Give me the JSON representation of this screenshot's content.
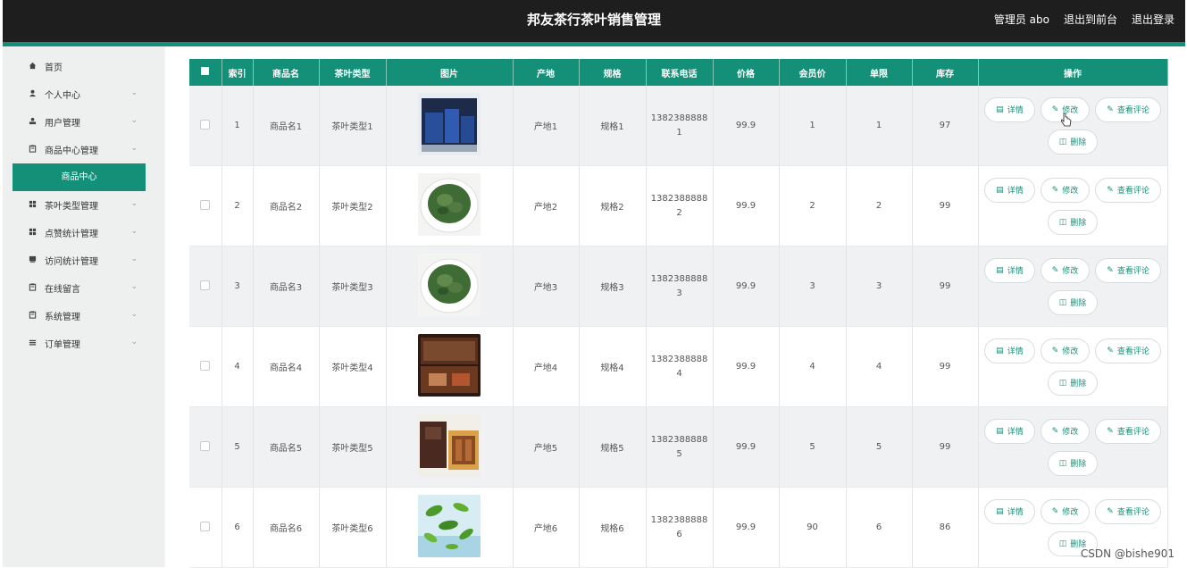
{
  "header": {
    "title": "邦友茶行茶叶销售管理",
    "admin": "管理员 abo",
    "front": "退出到前台",
    "logout": "退出登录"
  },
  "sidebar": {
    "items": [
      {
        "label": "首页",
        "icon": "home-icon",
        "chevron": false
      },
      {
        "label": "个人中心",
        "icon": "person-icon",
        "chevron": true
      },
      {
        "label": "用户管理",
        "icon": "user-icon",
        "chevron": true
      },
      {
        "label": "商品中心管理",
        "icon": "clipboard-icon",
        "chevron": true
      },
      {
        "label": "茶叶类型管理",
        "icon": "grid-icon",
        "chevron": true
      },
      {
        "label": "点赞统计管理",
        "icon": "grid-icon",
        "chevron": true
      },
      {
        "label": "访问统计管理",
        "icon": "book-icon",
        "chevron": true
      },
      {
        "label": "在线留言",
        "icon": "clipboard-icon",
        "chevron": true
      },
      {
        "label": "系统管理",
        "icon": "clipboard-icon",
        "chevron": true
      },
      {
        "label": "订单管理",
        "icon": "list-icon",
        "chevron": true
      }
    ],
    "active_sub": "商品中心"
  },
  "table": {
    "headers": [
      "索引",
      "商品名",
      "茶叶类型",
      "图片",
      "产地",
      "规格",
      "联系电话",
      "价格",
      "会员价",
      "单限",
      "库存",
      "操作"
    ],
    "rows": [
      {
        "idx": "1",
        "name": "商品名1",
        "type": "茶叶类型1",
        "img": "blue-gift-box",
        "origin": "产地1",
        "spec": "规格1",
        "phone1": "1382388888",
        "phone2": "1",
        "price": "99.9",
        "member": "1",
        "limit": "1",
        "stock": "97"
      },
      {
        "idx": "2",
        "name": "商品名2",
        "type": "茶叶类型2",
        "img": "green-tea-bowl",
        "origin": "产地2",
        "spec": "规格2",
        "phone1": "1382388888",
        "phone2": "2",
        "price": "99.9",
        "member": "2",
        "limit": "2",
        "stock": "99"
      },
      {
        "idx": "3",
        "name": "商品名3",
        "type": "茶叶类型3",
        "img": "green-tea-bowl",
        "origin": "产地3",
        "spec": "规格3",
        "phone1": "1382388888",
        "phone2": "3",
        "price": "99.9",
        "member": "3",
        "limit": "3",
        "stock": "99"
      },
      {
        "idx": "4",
        "name": "商品名4",
        "type": "茶叶类型4",
        "img": "wooden-tea-box",
        "origin": "产地4",
        "spec": "规格4",
        "phone1": "1382388888",
        "phone2": "4",
        "price": "99.9",
        "member": "4",
        "limit": "4",
        "stock": "99"
      },
      {
        "idx": "5",
        "name": "商品名5",
        "type": "茶叶类型5",
        "img": "tea-gift-set",
        "origin": "产地5",
        "spec": "规格5",
        "phone1": "1382388888",
        "phone2": "5",
        "price": "99.9",
        "member": "5",
        "limit": "5",
        "stock": "99"
      },
      {
        "idx": "6",
        "name": "商品名6",
        "type": "茶叶类型6",
        "img": "flying-tea-leaves",
        "origin": "产地6",
        "spec": "规格6",
        "phone1": "1382388888",
        "phone2": "6",
        "price": "99.9",
        "member": "90",
        "limit": "6",
        "stock": "86"
      }
    ],
    "actions": {
      "detail": "详情",
      "edit": "修改",
      "review": "查看评论",
      "delete": "删除"
    }
  },
  "watermark": "CSDN @bishe901",
  "colors": {
    "accent": "#149078",
    "topbar": "#1e1e1e",
    "sidebar": "#eef0f0"
  }
}
